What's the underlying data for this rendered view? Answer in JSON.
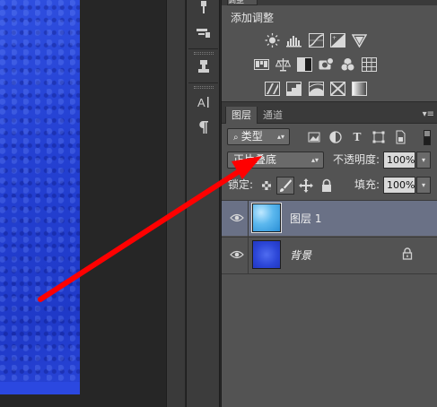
{
  "adjustments": {
    "tab_label": "调整",
    "title": "添加调整"
  },
  "layers": {
    "tabs": [
      {
        "label": "图层"
      },
      {
        "label": "通道"
      }
    ],
    "filter_kind": "类型",
    "blend_mode": "正片叠底",
    "opacity_label": "不透明度:",
    "opacity_value": "100%",
    "lock_label": "锁定:",
    "fill_label": "填充:",
    "fill_value": "100%",
    "items": [
      {
        "name": "图层 1",
        "selected": true
      },
      {
        "name": "背景",
        "locked": true
      }
    ]
  },
  "colors": {
    "annotation_arrow": "#ff0000",
    "canvas_fill": "#2440d2",
    "selected_layer": "#6a7186"
  }
}
